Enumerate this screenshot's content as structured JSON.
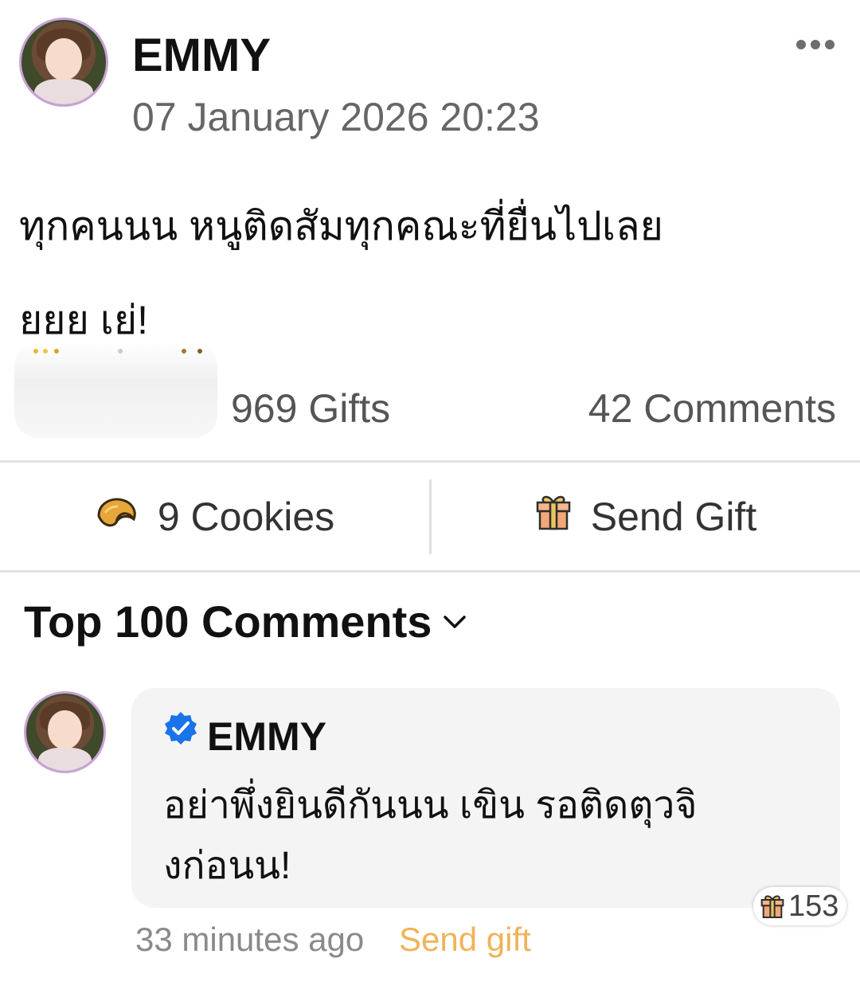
{
  "post": {
    "author": "EMMY",
    "timestamp": "07 January 2026 20:23",
    "body_line1": "ทุกคนนน หนูติดสัมทุกคณะที่ยื่นไปเลย",
    "body_line2": "ยยย เย่!",
    "gifts_count": "969 Gifts",
    "comments_count": "42 Comments"
  },
  "actions": {
    "cookies_label": "9 Cookies",
    "cookie_icon": "fortune-cookie-icon",
    "send_gift_label": "Send Gift",
    "gift_icon": "gift-box-icon"
  },
  "comments_section": {
    "header": "Top 100 Comments",
    "header_icon": "chevron-down-icon"
  },
  "comments": [
    {
      "author": "EMMY",
      "verified": true,
      "text": "อย่าพึ่งยินดีกันนน เขิน รอติดตุวจิงก่อนน!",
      "gift_count": "153",
      "time": "33 minutes ago",
      "send_gift_label": "Send gift"
    }
  ],
  "colors": {
    "accent_gift": "#f0b35a",
    "verified_blue": "#1a73e8",
    "avatar_ring": "#c8a2d6"
  }
}
